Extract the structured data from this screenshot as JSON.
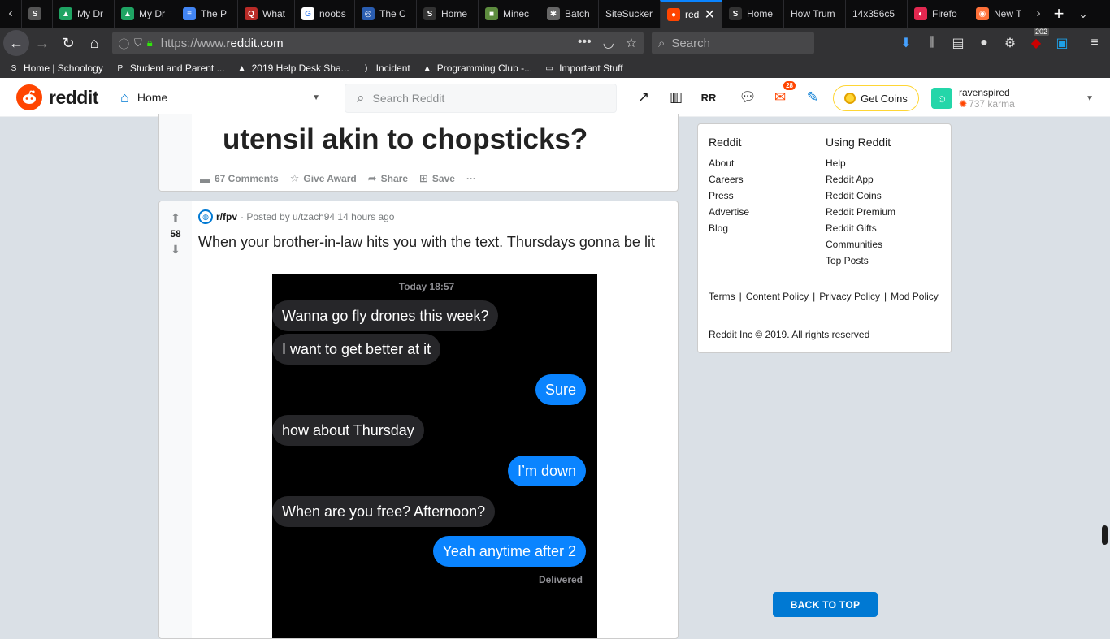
{
  "browser": {
    "tabs": [
      {
        "label": "e P",
        "fav": "S",
        "color": "#555"
      },
      {
        "label": "My Dr",
        "fav": "▲",
        "color": "#1fa463"
      },
      {
        "label": "My Dr",
        "fav": "▲",
        "color": "#1fa463"
      },
      {
        "label": "The P",
        "fav": "≡",
        "color": "#4285f4"
      },
      {
        "label": "What",
        "fav": "Q",
        "color": "#b92b27"
      },
      {
        "label": "noobs",
        "fav": "G",
        "color": "#fff"
      },
      {
        "label": "The C",
        "fav": "◎",
        "color": "#2a5db0"
      },
      {
        "label": "Home",
        "fav": "S",
        "color": "#333"
      },
      {
        "label": "Minec",
        "fav": "■",
        "color": "#5d8c3e"
      },
      {
        "label": "Batch",
        "fav": "✱",
        "color": "#666"
      },
      {
        "label": "SiteSucker",
        "fav": "",
        "color": "#0c0c0d"
      },
      {
        "label": "red",
        "fav": "●",
        "color": "#ff4500",
        "active": true
      },
      {
        "label": "Home",
        "fav": "S",
        "color": "#333"
      },
      {
        "label": "How Trum",
        "fav": "",
        "color": "#0c0c0d"
      },
      {
        "label": "14x356c5",
        "fav": "",
        "color": "#0c0c0d"
      },
      {
        "label": "Firefo",
        "fav": "◐",
        "color": "#e22850"
      },
      {
        "label": "New T",
        "fav": "◉",
        "color": "#ff7139"
      }
    ],
    "url_prefix": "https://www.",
    "url_host": "reddit.com",
    "search_placeholder": "Search",
    "badge_count": "202",
    "bookmarks": [
      {
        "label": "Home | Schoology",
        "icon": "S"
      },
      {
        "label": "Student and Parent ...",
        "icon": "P"
      },
      {
        "label": "2019 Help Desk Sha...",
        "icon": "▲"
      },
      {
        "label": "Incident",
        "icon": ")"
      },
      {
        "label": "Programming Club -...",
        "icon": "▲"
      },
      {
        "label": "Important Stuff",
        "icon": "▭"
      }
    ]
  },
  "reddit": {
    "wordmark": "reddit",
    "home_label": "Home",
    "search_placeholder": "Search Reddit",
    "mail_badge": "28",
    "get_coins": "Get Coins",
    "username": "ravenspired",
    "karma": "737 karma"
  },
  "post1": {
    "title": "utensil akin to chopsticks?",
    "comments": "67 Comments",
    "give_award": "Give Award",
    "share": "Share",
    "save": "Save",
    "more": "···"
  },
  "post2": {
    "votes": "58",
    "subreddit": "r/fpv",
    "posted_by": "· Posted by u/tzach94 14 hours ago",
    "title": "When your brother-in-law hits you with the text. Thursdays gonna be lit",
    "image": {
      "time": "Today 18:57",
      "messages": [
        {
          "text": "Wanna go fly drones this week?",
          "dir": "in"
        },
        {
          "text": "I want to get better at it",
          "dir": "in"
        },
        {
          "text": "Sure",
          "dir": "out"
        },
        {
          "text": "how about Thursday",
          "dir": "in"
        },
        {
          "text": "I’m down",
          "dir": "out"
        },
        {
          "text": "When are you free? Afternoon?",
          "dir": "in"
        },
        {
          "text": "Yeah anytime after 2",
          "dir": "out"
        }
      ],
      "delivered": "Delivered"
    }
  },
  "sidebar": {
    "col1_head": "Reddit",
    "col1": [
      "About",
      "Careers",
      "Press",
      "Advertise",
      "Blog"
    ],
    "col2_head": "Using Reddit",
    "col2": [
      "Help",
      "Reddit App",
      "Reddit Coins",
      "Reddit Premium",
      "Reddit Gifts",
      "Communities",
      "Top Posts"
    ],
    "legal": [
      "Terms",
      "Content Policy",
      "Privacy Policy",
      "Mod Policy"
    ],
    "copyright": "Reddit Inc © 2019. All rights reserved"
  },
  "back_to_top": "BACK TO TOP"
}
